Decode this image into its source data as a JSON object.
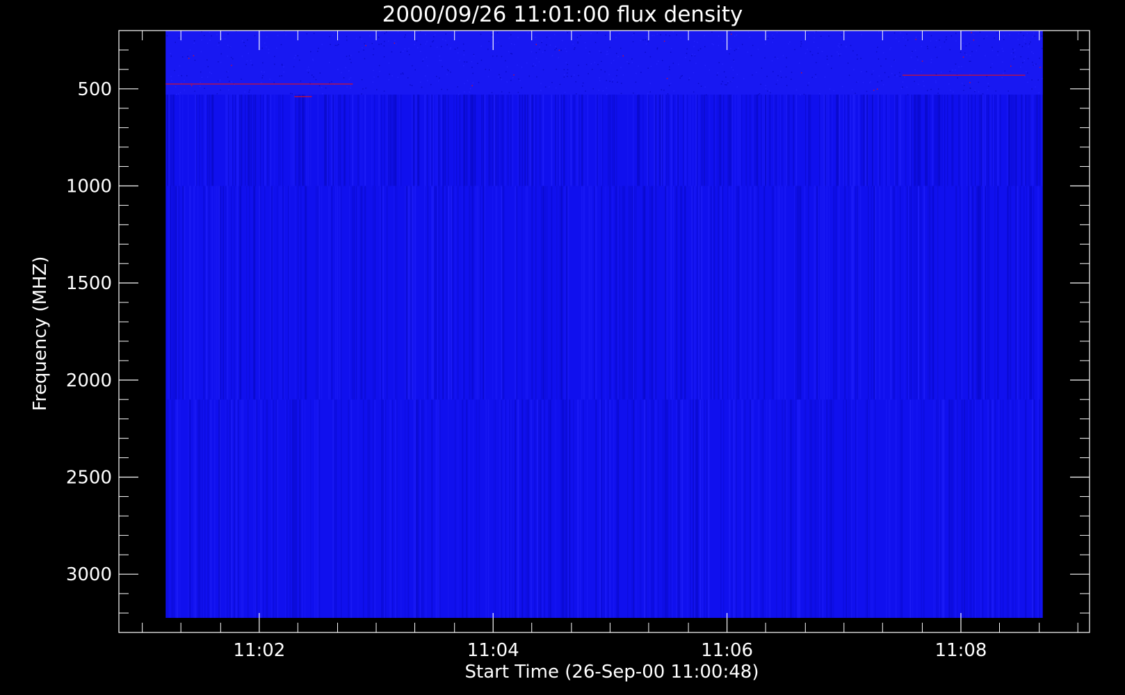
{
  "chart_data": {
    "type": "heatmap",
    "title": "2000/09/26 11:01:00 flux density",
    "xlabel": "Start Time (26-Sep-00 11:00:48)",
    "ylabel": "Frequency (MHZ)",
    "x_range_minutes_after_1100": [
      0.8,
      9.1
    ],
    "data_x_range_minutes_after_1100": [
      1.2,
      8.7
    ],
    "x_ticks": [
      {
        "label": "11:02",
        "minute": 2
      },
      {
        "label": "11:04",
        "minute": 4
      },
      {
        "label": "11:06",
        "minute": 6
      },
      {
        "label": "11:08",
        "minute": 8
      }
    ],
    "x_minor_minutes": [
      1.0,
      1.33,
      1.67,
      2.33,
      2.67,
      3.0,
      3.33,
      3.67,
      4.33,
      4.67,
      5.0,
      5.33,
      5.67,
      6.33,
      6.67,
      7.0,
      7.33,
      7.67,
      8.33,
      8.67,
      9.0
    ],
    "y_range_mhz": [
      200,
      3300
    ],
    "data_y_range_mhz": [
      200,
      3225
    ],
    "y_inverted": true,
    "y_ticks": [
      {
        "label": "500",
        "value": 500
      },
      {
        "label": "1000",
        "value": 1000
      },
      {
        "label": "1500",
        "value": 1500
      },
      {
        "label": "2000",
        "value": 2000
      },
      {
        "label": "2500",
        "value": 2500
      },
      {
        "label": "3000",
        "value": 3000
      }
    ],
    "y_minor_step_mhz": 100,
    "colors": {
      "background": "#000000",
      "base": "#1010ee",
      "dark": "#0808c0",
      "light": "#2626ff",
      "axes": "#ffffff",
      "hot": "#cc1133"
    },
    "bands_mhz": [
      {
        "from": 200,
        "to": 530,
        "texture": "speckled"
      },
      {
        "from": 530,
        "to": 1000,
        "texture": "dense-stripes"
      },
      {
        "from": 1000,
        "to": 2100,
        "texture": "medium-stripes"
      },
      {
        "from": 2100,
        "to": 3225,
        "texture": "fine-stripes"
      }
    ],
    "hot_lines": [
      {
        "minute_start": 7.5,
        "minute_end": 8.55,
        "mhz": 430
      },
      {
        "minute_start": 2.3,
        "minute_end": 2.45,
        "mhz": 540
      },
      {
        "minute_start": 1.2,
        "minute_end": 2.8,
        "mhz": 475
      }
    ]
  }
}
